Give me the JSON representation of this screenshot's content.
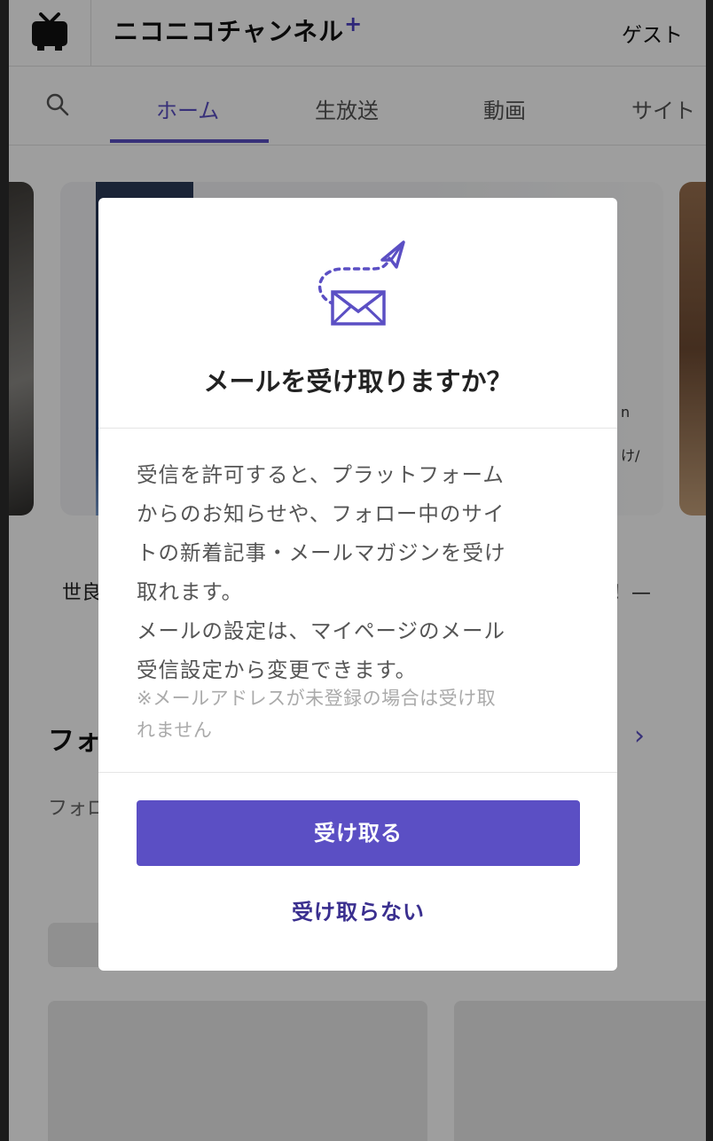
{
  "header": {
    "brand": "ニコニコチャンネル",
    "brand_plus": "+",
    "guest": "ゲスト"
  },
  "nav": {
    "tabs": [
      {
        "label": "ホーム",
        "active": true
      },
      {
        "label": "生放送",
        "active": false
      },
      {
        "label": "動画",
        "active": false
      },
      {
        "label": "サイト",
        "active": false
      }
    ]
  },
  "background": {
    "card_caption_left": "世良",
    "card_caption_right": "！—",
    "card_text_1": "n",
    "card_text_2": "け/",
    "section_heading": "フォ",
    "section_sub": "フォロ",
    "chevron": "›"
  },
  "modal": {
    "title": "メールを受け取りますか？",
    "body_lines": [
      "受信を許可すると、プラットフォーム",
      "からのお知らせや、フォロー中のサイ",
      "トの新着記事・メールマガジンを受け",
      "取れます。",
      "メールの設定は、マイページのメール",
      "受信設定から変更できます。"
    ],
    "note_lines": [
      "※メールアドレスが未登録の場合は受け取",
      "れません"
    ],
    "accept_label": "受け取る",
    "decline_label": "受け取らない"
  },
  "colors": {
    "accent": "#5b4fc4",
    "decline_text": "#3a2f8f"
  }
}
